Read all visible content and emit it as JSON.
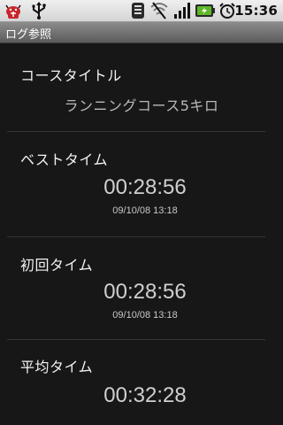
{
  "status_bar": {
    "time": "15:36",
    "icons": [
      "android-debug-icon",
      "usb-icon",
      "signal-stack-icon",
      "wifi-off-icon",
      "cell-signal-icon",
      "battery-charging-icon",
      "alarm-clock-icon"
    ]
  },
  "title_bar": {
    "title": "ログ参照"
  },
  "course": {
    "label": "コースタイトル",
    "value": "ランニングコース5キロ"
  },
  "best": {
    "label": "ベストタイム",
    "time": "00:28:56",
    "date": "09/10/08 13:18"
  },
  "first": {
    "label": "初回タイム",
    "time": "00:28:56",
    "date": "09/10/08 13:18"
  },
  "average": {
    "label": "平均タイム",
    "time": "00:32:28"
  },
  "colors": {
    "background": "#171717",
    "status_bar": "#e2e2e2",
    "title_bar": "#707070",
    "battery_accent": "#5fb829",
    "debug_icon": "#c8262b"
  }
}
